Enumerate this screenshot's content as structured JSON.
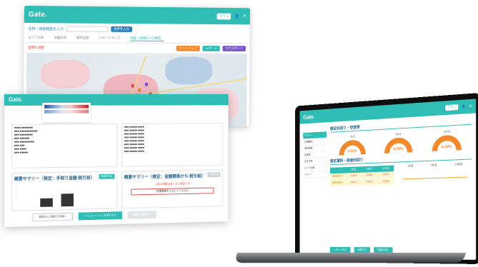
{
  "brand": {
    "logo": "Gate.",
    "accent": "#2fbdb5"
  },
  "map_window": {
    "logo": "Gate.",
    "search": {
      "label": "住所・緯度経度を入力",
      "value": "",
      "button": "住所を入力"
    },
    "tabs": [
      "エリア分析",
      "商圏分析",
      "物件比較",
      "ハザードマップ",
      "地図（地域の人口構成）"
    ],
    "tools": {
      "label": "面積を調整",
      "chips": [
        "ヒートマップ",
        "レポート",
        "エクスポート"
      ]
    }
  },
  "summary_window": {
    "logo": "Gate.",
    "card_left": {
      "title": "概要サマリー（推定：手取り金額 税引前）",
      "button": "詳細を見る"
    },
    "card_right": {
      "title": "概要サマリー（推定：金額関係から 税引前）",
      "button": "比較する",
      "note": "※表示結果はあくまで推定です",
      "box": "詳細情報を入力してください"
    },
    "buttons": [
      "前回の入力値を引き継ぐ",
      "シミュレーションを実行する",
      "結果を保存する"
    ]
  },
  "laptop": {
    "logo": "Gate.",
    "badge": "プラン",
    "side_items": [
      "サマリー",
      "市場動向",
      "賃料推移",
      "空室率",
      "収支予測",
      "エリア比較",
      "レポート"
    ],
    "section1": "想定利回り・空室率",
    "gauges": [
      {
        "caption": "1年目",
        "value": "5.92%"
      },
      {
        "caption": "5年目",
        "value": "6.09%"
      },
      {
        "caption": "10年目",
        "value": "6.28%"
      }
    ],
    "section2": "想定賃料・表面利回り",
    "table": {
      "headers": [
        "",
        "1年目",
        "5年目",
        "10年目"
      ],
      "rows": [
        [
          "表面利回り",
          "5.92%",
          "6.09%",
          "6.28%"
        ],
        [
          "実質利回り",
          "4.87%",
          "5.01%",
          "5.16%"
        ]
      ]
    },
    "chart_cols": [
      "1年目",
      "5年目",
      "10年目"
    ],
    "buttons": [
      "レポート出力",
      "比較する",
      "詳細を見る"
    ]
  }
}
